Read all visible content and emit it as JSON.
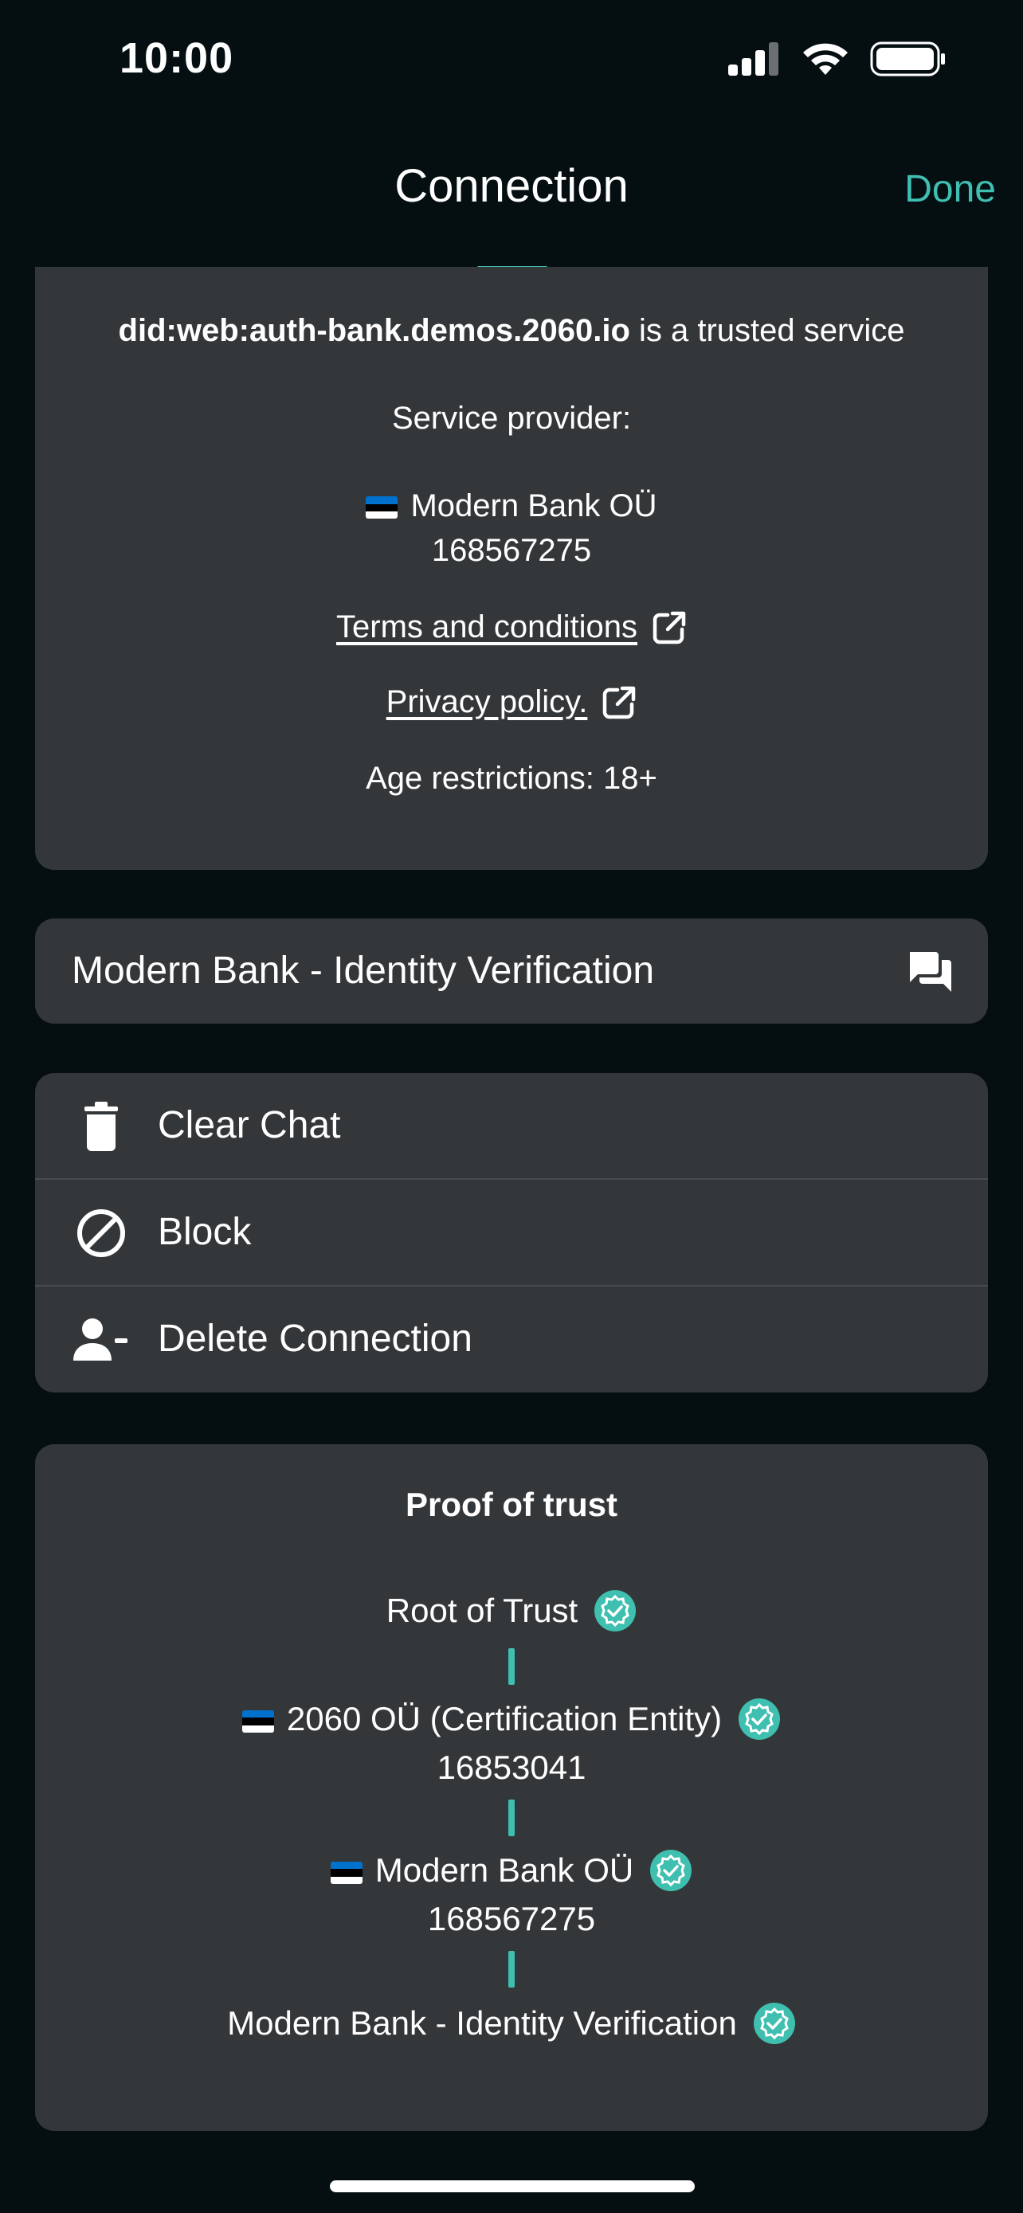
{
  "status_bar": {
    "time": "10:00"
  },
  "nav": {
    "title": "Connection",
    "done_label": "Done"
  },
  "service_info": {
    "did": "did:web:auth-bank.demos.2060.io",
    "trusted_suffix": " is a trusted service",
    "provider_label": "Service provider:",
    "provider_name": "Modern Bank OÜ",
    "provider_id": "168567275",
    "terms_label": "Terms and conditions",
    "privacy_label": "Privacy policy.",
    "age_restrictions": "Age restrictions: 18+"
  },
  "chat": {
    "label": "Modern Bank - Identity Verification",
    "icon": "chat-bubbles-icon"
  },
  "actions": [
    {
      "label": "Clear Chat",
      "icon": "trash-icon"
    },
    {
      "label": "Block",
      "icon": "block-icon"
    },
    {
      "label": "Delete Connection",
      "icon": "person-remove-icon"
    }
  ],
  "proof_of_trust": {
    "title": "Proof of trust",
    "chain": [
      {
        "name": "Root of Trust",
        "id": ""
      },
      {
        "name": "2060 OÜ (Certification Entity)",
        "id": "16853041"
      },
      {
        "name": "Modern Bank OÜ",
        "id": "168567275"
      },
      {
        "name": "Modern Bank - Identity Verification",
        "id": ""
      }
    ]
  },
  "colors": {
    "accent": "#3fbfb0",
    "background": "#050f12",
    "card": "#343739"
  }
}
